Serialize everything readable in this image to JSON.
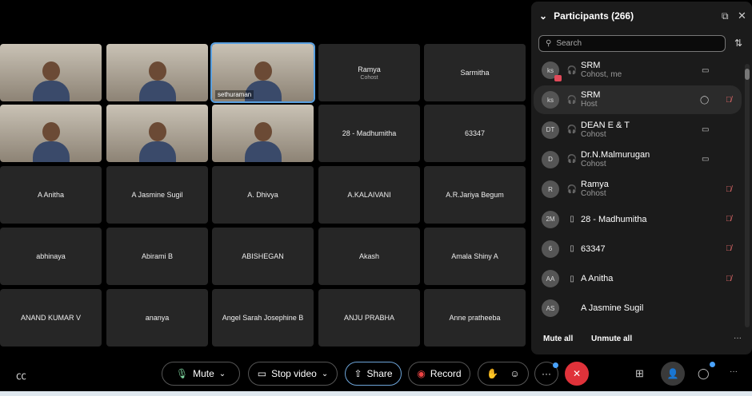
{
  "tiles": [
    {
      "name": "",
      "video": true
    },
    {
      "name": "",
      "video": true
    },
    {
      "name": "sethuraman",
      "video": true,
      "active": true
    },
    {
      "name": "Ramya",
      "sub": "Cohost"
    },
    {
      "name": "Sarmitha"
    },
    {
      "name": "",
      "video": true
    },
    {
      "name": "",
      "video": true
    },
    {
      "name": "",
      "video": true
    },
    {
      "name": "28 - Madhumitha"
    },
    {
      "name": "63347"
    },
    {
      "name": "A Anitha"
    },
    {
      "name": "A Jasmine Sugil"
    },
    {
      "name": "A. Dhivya"
    },
    {
      "name": "A.KALAIVANI"
    },
    {
      "name": "A.R.Jariya Begum"
    },
    {
      "name": "abhinaya"
    },
    {
      "name": "Abirami B"
    },
    {
      "name": "ABISHEGAN"
    },
    {
      "name": "Akash"
    },
    {
      "name": "Amala Shiny A"
    },
    {
      "name": "ANAND KUMAR V"
    },
    {
      "name": "ananya"
    },
    {
      "name": "Angel Sarah Josephine B"
    },
    {
      "name": "ANJU PRABHA"
    },
    {
      "name": "Anne pratheeba"
    }
  ],
  "panel": {
    "title": "Participants (266)",
    "search_placeholder": "Search",
    "mute_all": "Mute all",
    "unmute_all": "Unmute all",
    "participants": [
      {
        "initials": "ks",
        "name": "SRM",
        "role": "Cohost, me",
        "device": "headset",
        "status": "video"
      },
      {
        "initials": "ks",
        "name": "SRM",
        "role": "Host",
        "device": "headset",
        "status": "chat-muted"
      },
      {
        "initials": "DT",
        "name": "DEAN E & T",
        "role": "Cohost",
        "device": "headset",
        "status": "video"
      },
      {
        "initials": "D",
        "name": "Dr.N.Malmurugan",
        "role": "Cohost",
        "device": "headset",
        "status": "video"
      },
      {
        "initials": "R",
        "name": "Ramya",
        "role": "Cohost",
        "device": "headset",
        "status": "muted"
      },
      {
        "initials": "2M",
        "name": "28 - Madhumitha",
        "role": "",
        "device": "phone",
        "status": "muted-locked"
      },
      {
        "initials": "6",
        "name": "63347",
        "role": "",
        "device": "phone",
        "status": "muted-locked"
      },
      {
        "initials": "AA",
        "name": "A Anitha",
        "role": "",
        "device": "phone",
        "status": "muted-locked"
      },
      {
        "initials": "AS",
        "name": "A Jasmine Sugil",
        "role": "",
        "device": "",
        "status": ""
      }
    ]
  },
  "toolbar": {
    "mute": "Mute",
    "stop_video": "Stop video",
    "share": "Share",
    "record": "Record"
  }
}
